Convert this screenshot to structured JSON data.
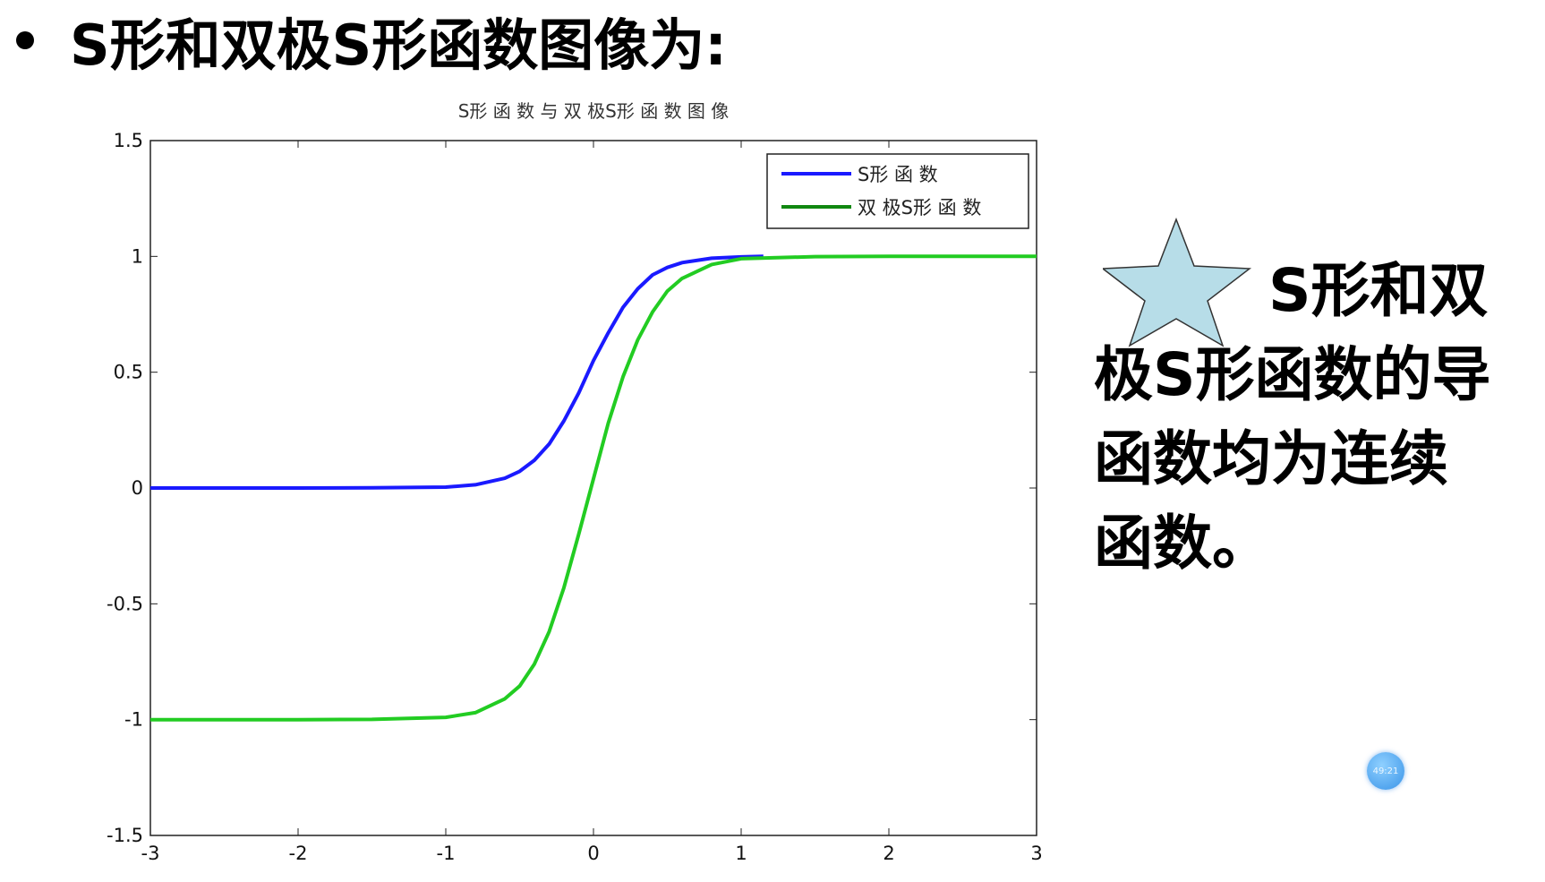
{
  "heading": {
    "bullet": "•",
    "text": "S形和双极S形函数图像为:"
  },
  "side_note": {
    "star_icon": "star-icon",
    "line1": "S形和双",
    "line2": "极S形函数的导",
    "line3": "函数均为连续",
    "line4": "函数。"
  },
  "timer_badge": "49:21",
  "colors": {
    "sigmoid": "#1a1aff",
    "bipolar": "#22cc22",
    "star_fill": "#b7dde8"
  },
  "chart_data": {
    "type": "line",
    "title": "S形 函 数 与 双 极S形 函 数 图 像",
    "xlabel": "",
    "ylabel": "",
    "xlim": [
      -3,
      3
    ],
    "ylim": [
      -1.5,
      1.5
    ],
    "xticks": [
      -3,
      -2,
      -1,
      0,
      1,
      2,
      3
    ],
    "yticks": [
      -1.5,
      -1,
      -0.5,
      0,
      0.5,
      1,
      1.5
    ],
    "ytick_labels": [
      "-1.5",
      "-1",
      "-0.5",
      "0",
      "0.5",
      "1",
      "1.5"
    ],
    "grid": false,
    "legend": "top-right",
    "x": [
      -3,
      -2.5,
      -2,
      -1.5,
      -1,
      -0.8,
      -0.6,
      -0.5,
      -0.4,
      -0.3,
      -0.2,
      -0.1,
      0,
      0.1,
      0.2,
      0.3,
      0.4,
      0.5,
      0.6,
      0.8,
      1,
      1.5,
      2,
      2.5,
      3
    ],
    "series": [
      {
        "name": "S形 函 数",
        "color": "#1a1aff",
        "x_end": 1.15,
        "values": [
          0,
          0,
          0,
          0.001,
          0.004,
          0.014,
          0.042,
          0.072,
          0.12,
          0.19,
          0.29,
          0.41,
          0.55,
          0.67,
          0.78,
          0.86,
          0.92,
          0.952,
          0.973,
          0.992,
          0.998,
          1.0,
          1.0,
          1.0,
          1.0
        ]
      },
      {
        "name": "双 极S形 函 数",
        "color": "#22cc22",
        "values": [
          -1.0,
          -1.0,
          -1.0,
          -0.999,
          -0.99,
          -0.97,
          -0.91,
          -0.855,
          -0.76,
          -0.62,
          -0.43,
          -0.2,
          0.04,
          0.28,
          0.48,
          0.64,
          0.76,
          0.85,
          0.905,
          0.965,
          0.99,
          0.999,
          1.0,
          1.0,
          1.0
        ]
      }
    ]
  }
}
